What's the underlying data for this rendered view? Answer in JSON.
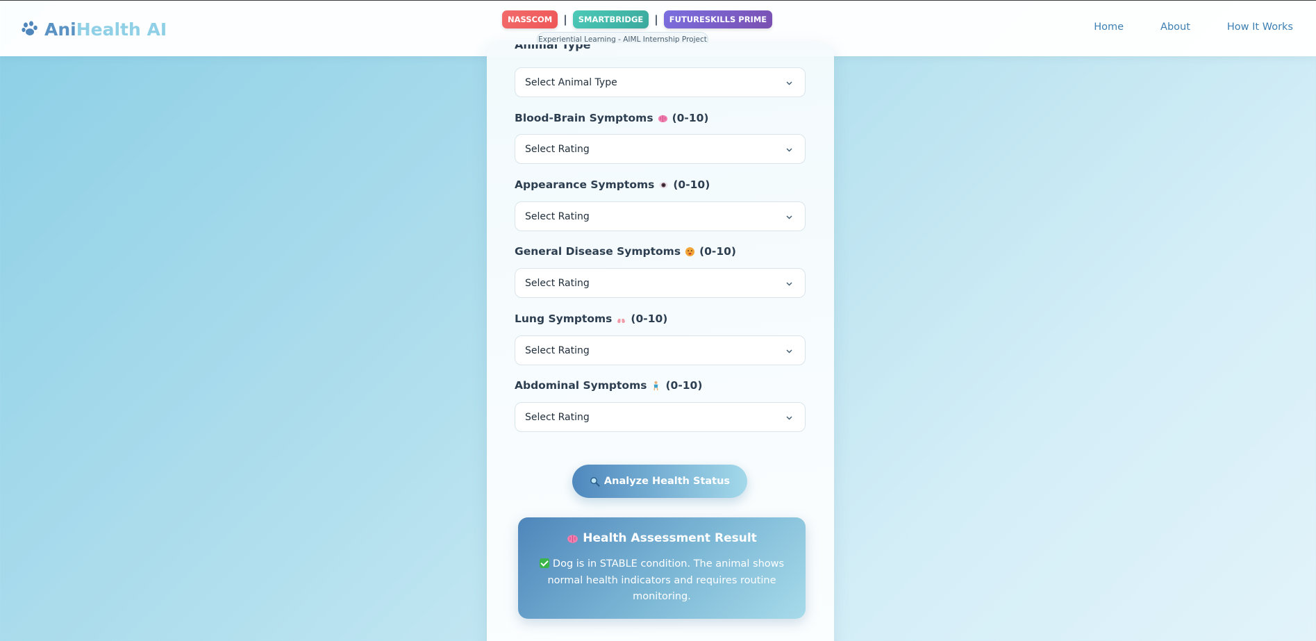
{
  "header": {
    "brand_part1": "Ani",
    "brand_part2": "Health AI",
    "brand_icon": "paw-icon",
    "badges": [
      "NASSCOM",
      "SMARTBRIDGE",
      "FUTURESKILLS PRIME"
    ],
    "separator": "|",
    "subtitle": "Experiential Learning - AIML Internship Project",
    "nav": [
      "Home",
      "About",
      "How It Works"
    ]
  },
  "form": {
    "partial_label": "Animal Type",
    "animal_select": {
      "value": "Select Animal Type"
    },
    "fields": [
      {
        "label": "Blood-Brain Symptoms",
        "icon": "brain-icon",
        "range": "(0-10)",
        "value": "Select Rating"
      },
      {
        "label": "Appearance Symptoms",
        "icon": "eye-icon",
        "range": "(0-10)",
        "value": "Select Rating"
      },
      {
        "label": "General Disease Symptoms",
        "icon": "sick-face-icon",
        "range": "(0-10)",
        "value": "Select Rating"
      },
      {
        "label": "Lung Symptoms",
        "icon": "lungs-icon",
        "range": "(0-10)",
        "value": "Select Rating"
      },
      {
        "label": "Abdominal Symptoms",
        "icon": "person-icon",
        "range": "(0-10)",
        "value": "Select Rating"
      }
    ],
    "analyze_button": "Analyze Health Status",
    "analyze_icon": "magnifier-icon"
  },
  "result": {
    "icon": "brain-icon",
    "title": "Health Assessment Result",
    "status_icon": "check-icon",
    "text": "Dog is in STABLE condition. The animal shows normal health indicators and requires routine monitoring."
  },
  "colors": {
    "brand_dark": "#5a92c4",
    "brand_light": "#8fd0e6",
    "nav_link": "#3d7fb2",
    "badge_nasscom": "#ee5657",
    "badge_smartbridge": "#3aa89c",
    "badge_futureskills": "#7a4fb0"
  }
}
